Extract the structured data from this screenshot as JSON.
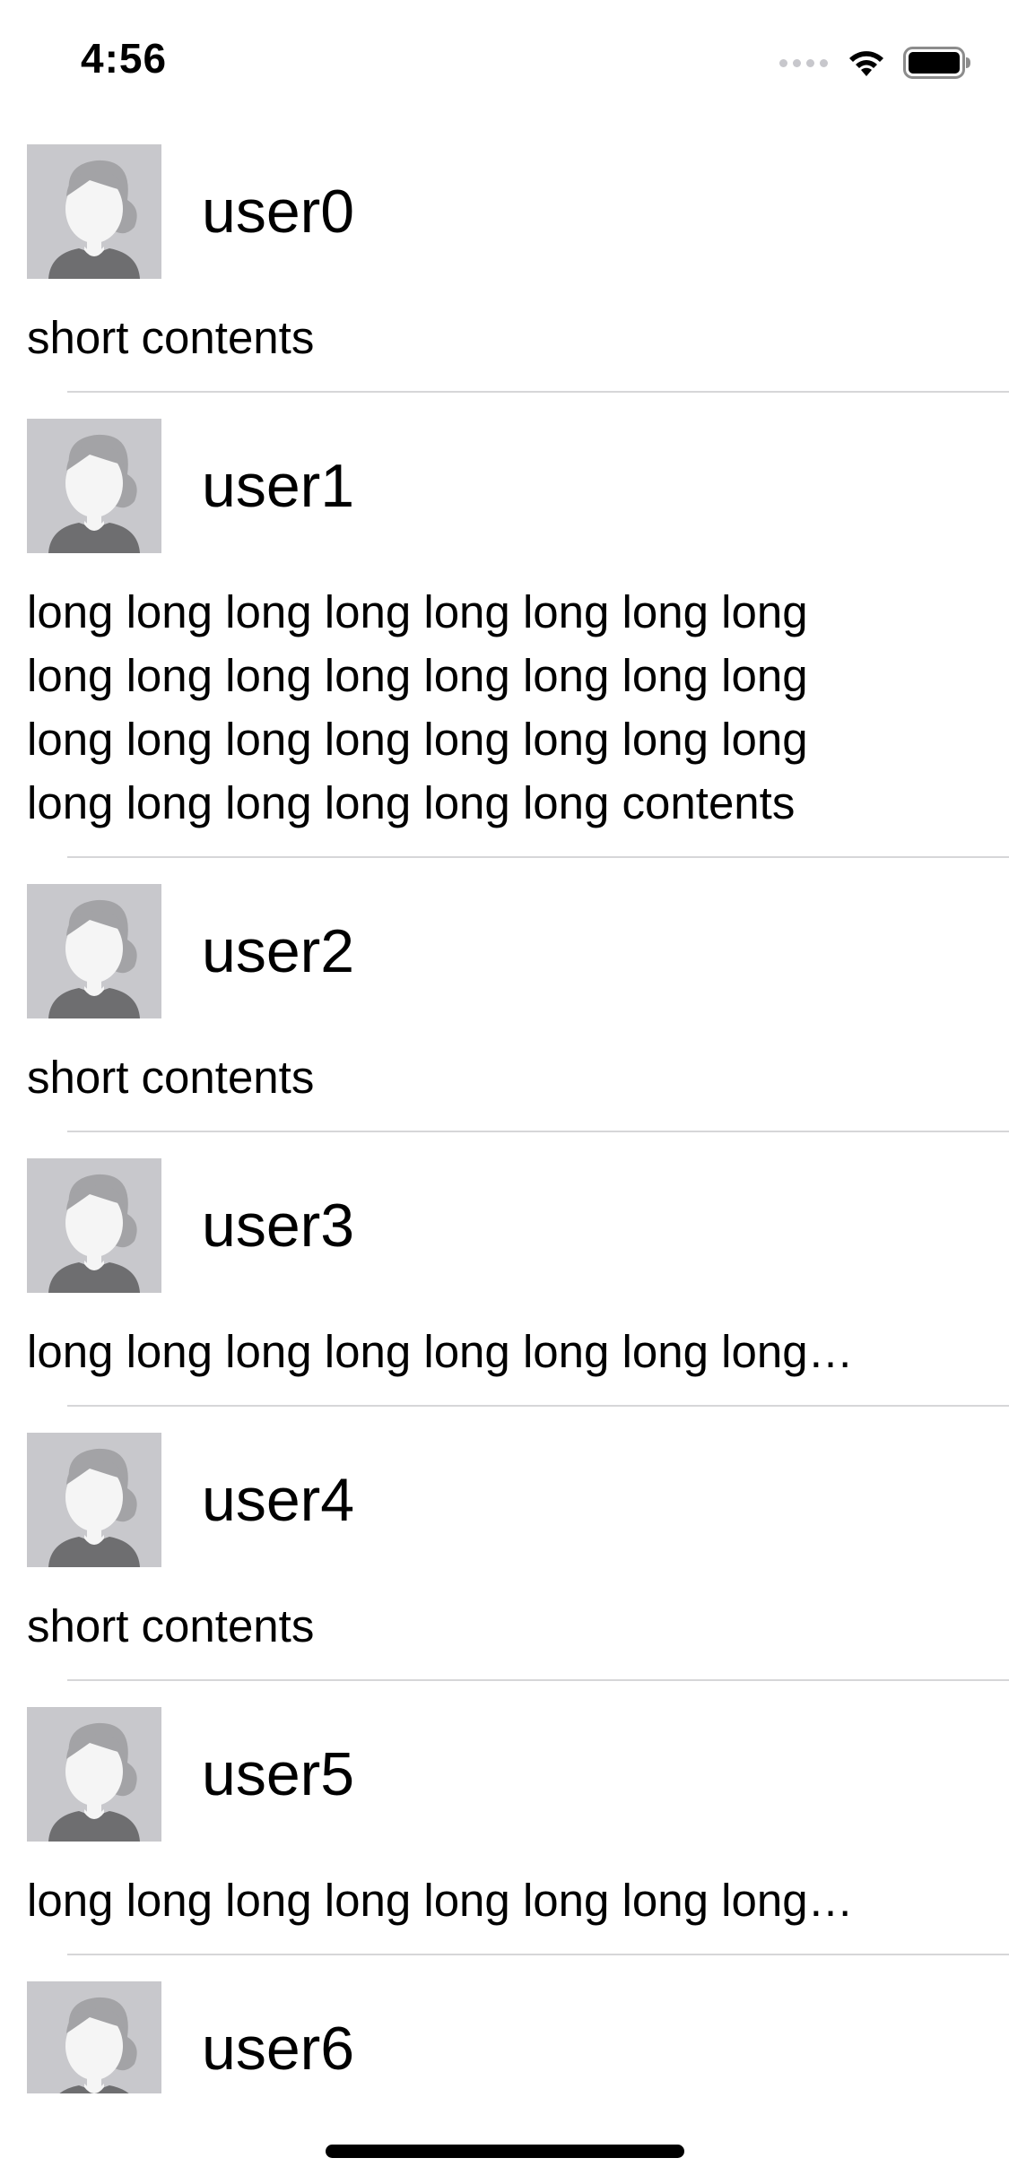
{
  "status_bar": {
    "time": "4:56",
    "icons": [
      "cellular-signal-icon",
      "wifi-icon",
      "battery-icon"
    ]
  },
  "feed": {
    "items": [
      {
        "username": "user0",
        "contents": "short contents"
      },
      {
        "username": "user1",
        "contents": "long long long long long long long long long long long long long long long long long long long long long long long long long long long long long long contents"
      },
      {
        "username": "user2",
        "contents": "short contents"
      },
      {
        "username": "user3",
        "contents": "long long long long long long long long…"
      },
      {
        "username": "user4",
        "contents": "short contents"
      },
      {
        "username": "user5",
        "contents": "long long long long long long long long…"
      },
      {
        "username": "user6",
        "contents": ""
      }
    ]
  },
  "colors": {
    "avatar_bg": "#c8c8cc",
    "separator": "#d6d6d8",
    "avatar_hair": "#a3a3a6",
    "avatar_face": "#f5f5f5",
    "avatar_body": "#6e6e70"
  }
}
